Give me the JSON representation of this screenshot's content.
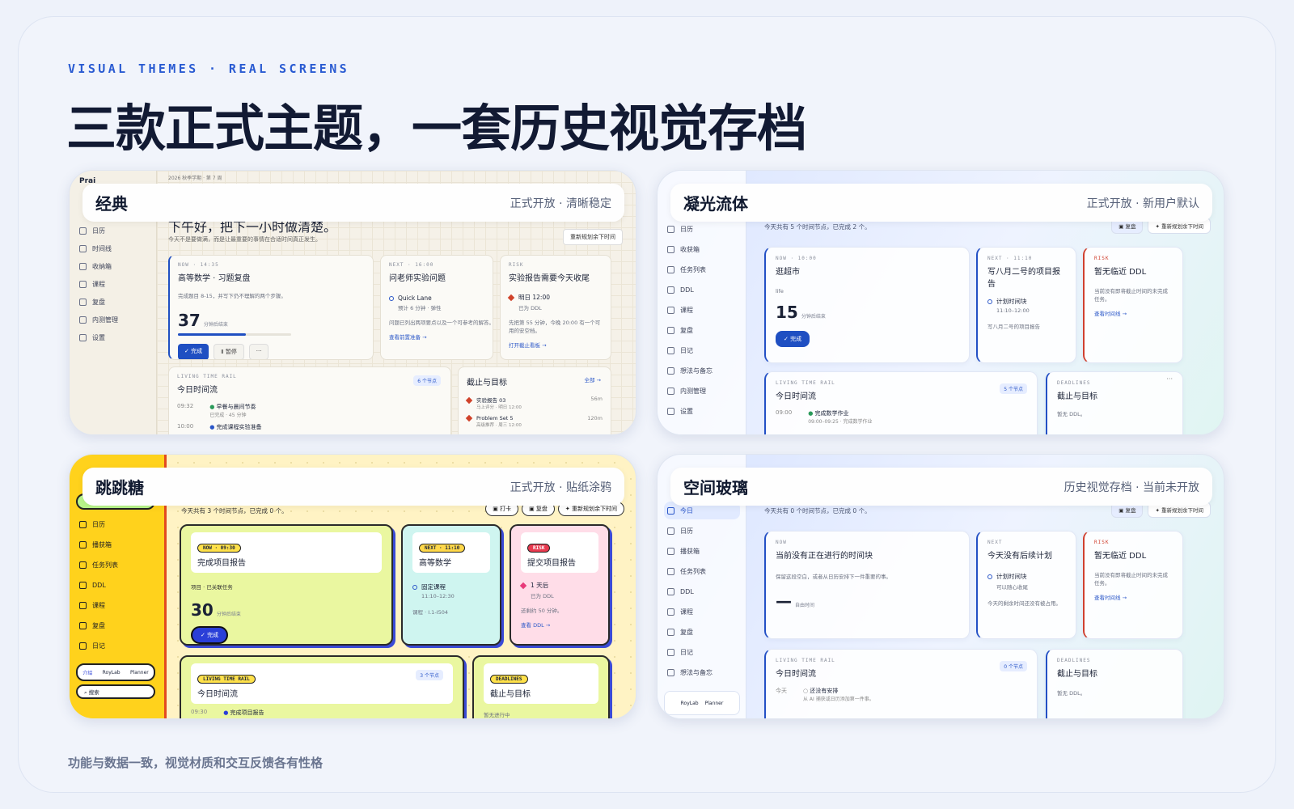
{
  "kicker": "VISUAL THEMES · REAL SCREENS",
  "headline": "三款正式主题，一套历史视觉存档",
  "footer": "功能与数据一致，视觉材质和交互反馈各有性格",
  "panels": {
    "classic": {
      "name": "经典",
      "status": "正式开放 · 清晰稳定",
      "brand": "Prai",
      "nav": [
        "日历",
        "时间线",
        "收纳箱",
        "课程",
        "复盘",
        "内测管理",
        "设置"
      ],
      "crumb": "2026 秋季学期 · 第 7 周",
      "greeting": "下午好，把下一小时做清楚。",
      "greeting_sub": "今天不是要做满，而是让最重要的事情在合适时间真正发生。",
      "replan": "重新规划余下时间",
      "now": {
        "label": "NOW · 14:35",
        "title": "高等数学 · 习题复盘",
        "desc": "完成题目 8-15，并写下仍不理解的两个步骤。",
        "num": "37",
        "unit": "分钟后结束",
        "progress": 0.6,
        "done": "完成",
        "pause": "暂停",
        "more": "···"
      },
      "next": {
        "label": "NEXT · 16:00",
        "title": "问老师实验问题",
        "item": "Quick Lane",
        "item_sub": "预计 6 分钟 · 弹性",
        "desc": "问题已列出两项要点以及一个可参考的解答。",
        "link": "查看前置准备"
      },
      "risk": {
        "label": "RISK",
        "title": "实验报告需要今天收尾",
        "item": "明日 12:00",
        "item_sub": "已为 DDL",
        "desc": "先把第 55 分钟，今晚 20:00 有一个可用的安空档。",
        "link": "打开截止看板"
      },
      "rail": {
        "label": "LIVING TIME RAIL",
        "title": "今日时间流",
        "badge": "6 个节点",
        "rows": [
          {
            "time": "09:32",
            "title": "早餐与晨间节奏",
            "sub": "已完成 · 45 分钟"
          },
          {
            "time": "10:00",
            "title": "完成课程实验准备",
            "sub": ""
          }
        ]
      },
      "ddl": {
        "title": "截止与目标",
        "all": "全部",
        "rows": [
          {
            "title": "实验报告 03",
            "sub": "马上评分 · 明日 12:00",
            "due": "56m"
          },
          {
            "title": "Problem Set 5",
            "sub": "高级推荐 · 周三 12:00",
            "due": "120m"
          }
        ]
      }
    },
    "glow": {
      "name": "凝光流体",
      "status": "正式开放 · 新用户默认",
      "nav": [
        "日历",
        "收获箱",
        "任务列表",
        "DDL",
        "课程",
        "复盘",
        "日记",
        "想法与备忘",
        "内测管理",
        "设置"
      ],
      "summary": "今天共有 5 个时间节点，已完成 2 个。",
      "review": "复盘",
      "replan": "重新规划余下时间",
      "now": {
        "label": "NOW · 10:00",
        "title": "逛超市",
        "desc": "life",
        "num": "15",
        "unit": "分钟后结束",
        "done": "完成"
      },
      "next": {
        "label": "NEXT · 11:10",
        "title": "写八月二号的项目报告",
        "item": "计划时间块",
        "item_sub": "11:10–12:00",
        "desc": "写八月二号的项目报告"
      },
      "risk": {
        "label": "RISK",
        "title": "暂无临近 DDL",
        "desc": "当前没有即将截止时间的未完成任务。",
        "link": "查看时间线"
      },
      "rail": {
        "label": "LIVING TIME RAIL",
        "title": "今日时间流",
        "badge": "5 个节点",
        "rows": [
          {
            "time": "09:00",
            "title": "完成数学作业",
            "sub": "09:00–09:25 · 完成数学作业"
          }
        ]
      },
      "ddl": {
        "label": "DEADLINES",
        "title": "截止与目标",
        "desc": "暂无 DDL。",
        "more": "···"
      }
    },
    "candy": {
      "name": "跳跳糖",
      "status": "正式开放 · 贴纸涂鸦",
      "nav": [
        "今日",
        "日历",
        "播获箱",
        "任务列表",
        "DDL",
        "课程",
        "复盘",
        "日记"
      ],
      "profile": {
        "intro": "介绍",
        "brand": "RoyLab",
        "role": "Planner"
      },
      "search": "搜索",
      "summary": "今天共有 3 个时间节点，已完成 0 个。",
      "punch": "打卡",
      "review": "复盘",
      "replan": "重新规划余下时间",
      "now": {
        "label": "NOW · 09:30",
        "title": "完成项目报告",
        "desc": "项目 · 已关联任务",
        "num": "30",
        "unit": "分钟后结束",
        "done": "完成"
      },
      "next": {
        "label": "NEXT · 11:10",
        "title": "高等数学",
        "item": "固定课程",
        "item_sub": "11:10–12:30",
        "desc": "课程 · I.1-I504"
      },
      "risk": {
        "label": "RISK",
        "title": "提交项目报告",
        "item": "1 天后",
        "item_sub": "已为 DDL",
        "desc": "还剩约 50 分钟。",
        "link": "查看 DDL"
      },
      "rail": {
        "label": "LIVING TIME RAIL",
        "title": "今日时间流",
        "badge": "3 个节点",
        "rows": [
          {
            "time": "09:30",
            "title": "完成项目报告"
          }
        ]
      },
      "ddl": {
        "label": "DEADLINES",
        "title": "截止与目标",
        "desc": "暂无进行中"
      }
    },
    "glass": {
      "name": "空间玻璃",
      "status": "历史视觉存档 · 当前未开放",
      "nav": [
        "今日",
        "日历",
        "播获箱",
        "任务列表",
        "DDL",
        "课程",
        "复盘",
        "日记",
        "想法与备忘"
      ],
      "profile": {
        "brand": "RoyLab",
        "role": "Planner"
      },
      "summary": "今天共有 0 个时间节点，已完成 0 个。",
      "review": "复盘",
      "replan": "重新规划余下时间",
      "now": {
        "label": "NOW",
        "title": "当前没有正在进行的时间块",
        "desc": "保留这段空白，或者从日历安排下一件重要的事。",
        "num": "—",
        "unit": "自由时间"
      },
      "next": {
        "label": "NEXT",
        "title": "今天没有后续计划",
        "item": "计划时间块",
        "item_sub": "可以随心收尾",
        "desc": "今天的剩余时间还没有被占用。"
      },
      "risk": {
        "label": "RISK",
        "title": "暂无临近 DDL",
        "desc": "当前没有即将截止时间的未完成任务。",
        "link": "查看时间线"
      },
      "rail": {
        "label": "LIVING TIME RAIL",
        "title": "今日时间流",
        "badge": "0 个节点",
        "rows": [
          {
            "time": "今天",
            "title": "还没有安排",
            "sub": "从 AI 捕获或日历添加第一件事。"
          }
        ]
      },
      "ddl": {
        "label": "DEADLINES",
        "title": "截止与目标",
        "desc": "暂无 DDL。"
      }
    }
  },
  "colors": {
    "accent": "#2a5bd2",
    "candy_side": "#ffd21c",
    "risk": "#d0402f"
  }
}
